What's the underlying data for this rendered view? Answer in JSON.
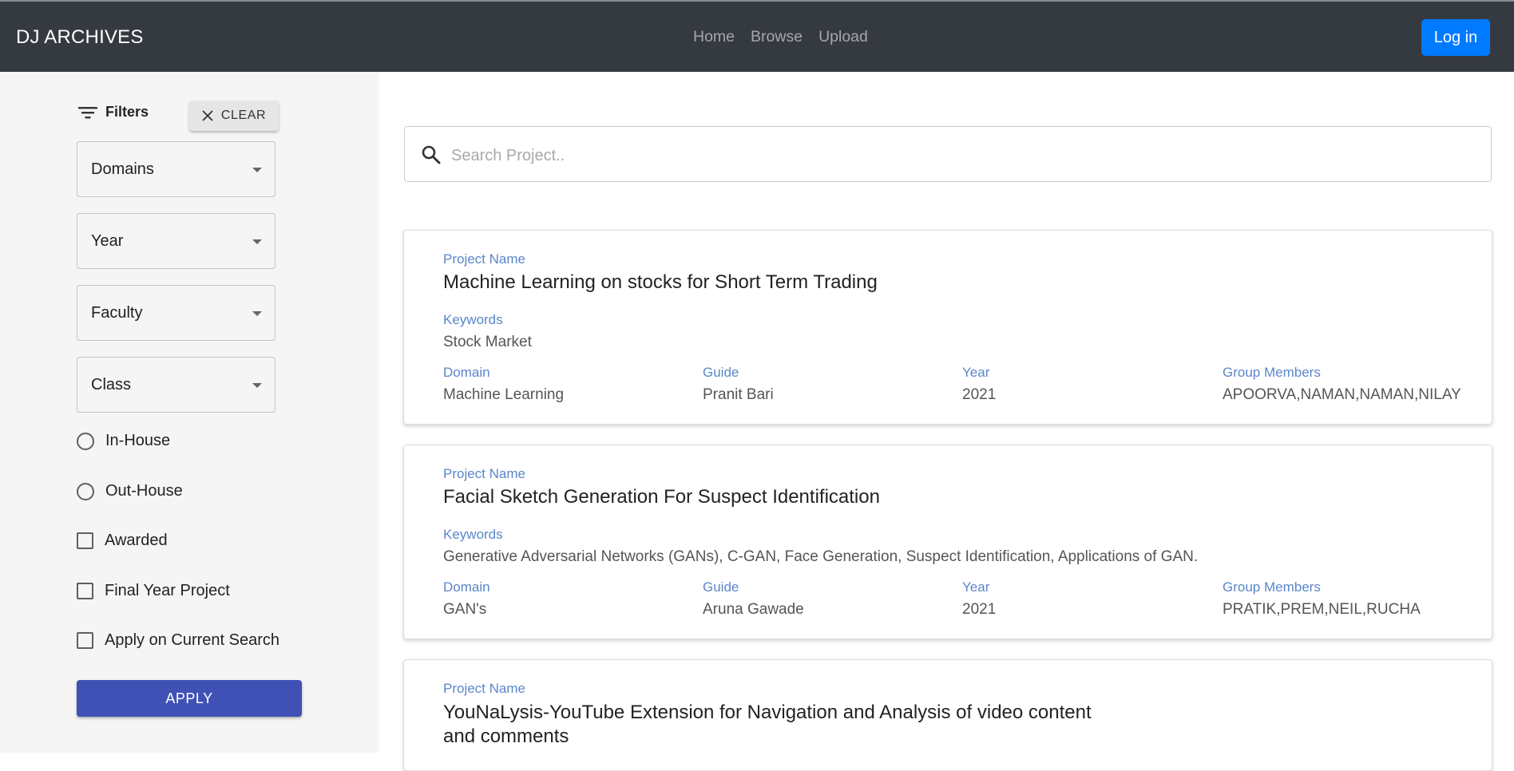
{
  "navbar": {
    "brand": "DJ ARCHIVES",
    "links": [
      "Home",
      "Browse",
      "Upload"
    ],
    "login_label": "Log in"
  },
  "sidebar": {
    "filters_label": "Filters",
    "clear_label": "CLEAR",
    "selects": [
      "Domains",
      "Year",
      "Faculty",
      "Class"
    ],
    "radios": [
      "In-House",
      "Out-House"
    ],
    "checkboxes": [
      "Awarded",
      "Final Year Project",
      "Apply on Current Search"
    ],
    "apply_label": "APPLY"
  },
  "search": {
    "placeholder": "Search Project.."
  },
  "labels": {
    "project_name": "Project Name",
    "keywords": "Keywords",
    "domain": "Domain",
    "guide": "Guide",
    "year": "Year",
    "group_members": "Group Members"
  },
  "projects": [
    {
      "name": "Machine Learning on stocks for Short Term Trading",
      "keywords": "Stock Market",
      "domain": "Machine Learning",
      "guide": "Pranit Bari",
      "year": "2021",
      "members": "APOORVA,NAMAN,NAMAN,NILAY"
    },
    {
      "name": "Facial Sketch Generation For Suspect Identification",
      "keywords": "Generative Adversarial Networks (GANs), C-GAN, Face Generation, Suspect Identification, Applications of GAN.",
      "domain": "GAN's",
      "guide": "Aruna Gawade",
      "year": "2021",
      "members": "PRATIK,PREM,NEIL,RUCHA"
    },
    {
      "name_line1": "YouNaLysis-YouTube Extension for Navigation and Analysis of video content",
      "name_line2": "and comments"
    }
  ],
  "colors": {
    "navbar_bg": "#343a40",
    "login_bg": "#007bff",
    "apply_bg": "#3f51b5",
    "label_color": "#5b86c9",
    "sidebar_bg": "#f5f5f5"
  }
}
